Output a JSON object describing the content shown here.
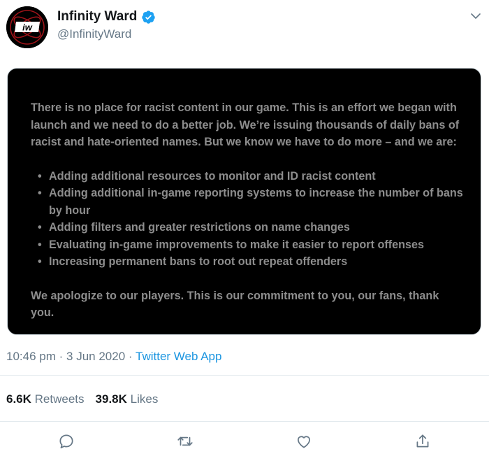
{
  "author": {
    "display_name": "Infinity Ward",
    "handle": "@InfinityWard",
    "avatar_icon": "infinity-ward-logo-icon",
    "verified_icon": "verified-badge-icon",
    "verified_color": "#1da1f2"
  },
  "media": {
    "intro": "There is no place for racist content in our game. This is an effort we began with launch and we need to do a better job. We’re issuing thousands of daily bans of racist and hate-oriented names.  But we know we have to do more – and we are:",
    "bullets": [
      "Adding additional resources to monitor and ID racist content",
      "Adding additional in-game reporting systems to increase the number of bans by hour",
      "Adding filters and greater restrictions on name changes",
      "Evaluating in-game improvements to make it easier to report offenses",
      "Increasing permanent bans to root out repeat offenders"
    ],
    "outro": "We apologize to our players. This is our commitment to you, our fans, thank you.",
    "background": "#000000",
    "text_color": "#8d8d8d"
  },
  "meta": {
    "time": "10:46 pm",
    "separator": "·",
    "date": "3 Jun 2020",
    "source": "Twitter Web App"
  },
  "stats": {
    "retweets_count": "6.6K",
    "retweets_label": "Retweets",
    "likes_count": "39.8K",
    "likes_label": "Likes"
  },
  "actions": [
    "reply-icon",
    "retweet-icon",
    "like-icon",
    "share-icon"
  ],
  "colors": {
    "accent": "#1b95e0",
    "muted": "#657786",
    "divider": "#e1e8ed"
  }
}
